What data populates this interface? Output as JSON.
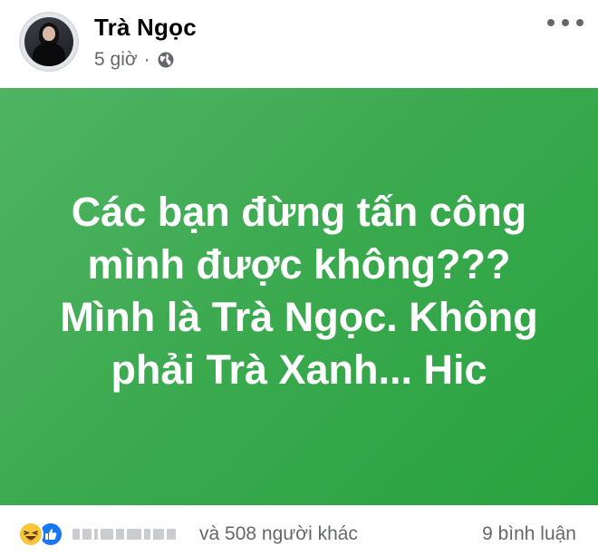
{
  "post": {
    "author": "Trà Ngọc",
    "time": "5 giờ",
    "separator": "·",
    "privacy_icon": "globe-icon",
    "menu_icon": "more-horizontal-icon",
    "background_colors": [
      "#4fb463",
      "#28a23f"
    ],
    "text_color": "#ffffff",
    "text_lines": [
      "Các bạn đừng tấn công",
      "mình được không???",
      "Mình là Trà Ngọc. Không",
      "phải Trà Xanh... Hic"
    ]
  },
  "footer": {
    "reaction_icons": [
      "haha-icon",
      "like-icon"
    ],
    "reaction_summary": "và 508 người khác",
    "comment_count": "9 bình luận"
  }
}
